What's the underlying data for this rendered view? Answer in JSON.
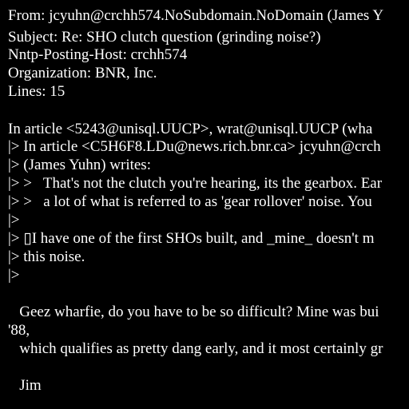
{
  "email": {
    "from": "From: jcyuhn@crchh574.NoSubdomain.NoDomain (James Y",
    "subject": "Subject: Re: SHO clutch question (grinding noise?)",
    "nntp_host": "Nntp-Posting-Host: crchh574",
    "organization": "Organization: BNR, Inc.",
    "lines": "Lines: 15",
    "body": [
      "In article <5243@unisql.UUCP>, wrat@unisql.UUCP (wha",
      "|> In article <C5H6F8.LDu@news.rich.bnr.ca> jcyuhn@crch",
      "|> (James Yuhn) writes:",
      "|> >   That's not the clutch you're hearing, its the gearbox. Ear",
      "|> >   a lot of what is referred to as 'gear rollover' noise. You",
      "|>",
      "|> ▯I have one of the first SHOs built, and _mine_ doesn't m",
      "|> this noise.",
      "|>",
      "   Geez wharfie, do you have to be so difficult? Mine was bui",
      "'88,",
      "   which qualifies as pretty dang early, and it most certainly gr",
      "   Jim"
    ]
  }
}
